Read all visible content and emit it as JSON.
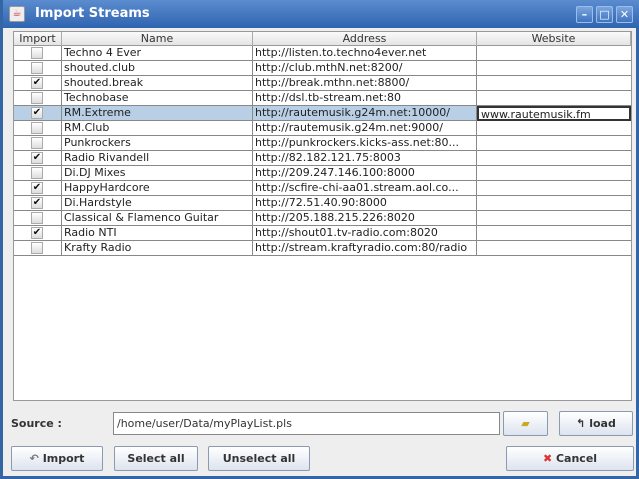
{
  "window": {
    "title": "Import Streams"
  },
  "table": {
    "headers": [
      "Import",
      "Name",
      "Address",
      "Website"
    ],
    "rows": [
      {
        "checked": false,
        "name": "Techno 4 Ever",
        "address": "http://listen.to.techno4ever.net",
        "website": ""
      },
      {
        "checked": false,
        "name": "shouted.club",
        "address": "http://club.mthN.net:8200/",
        "website": ""
      },
      {
        "checked": true,
        "name": "shouted.break",
        "address": "http://break.mthn.net:8800/",
        "website": ""
      },
      {
        "checked": false,
        "name": "Technobase",
        "address": "http://dsl.tb-stream.net:80",
        "website": ""
      },
      {
        "checked": true,
        "name": "RM.Extreme",
        "address": "http://rautemusik.g24m.net:10000/",
        "website": "www.rautemusik.fm",
        "selected": true
      },
      {
        "checked": false,
        "name": "RM.Club",
        "address": "http://rautemusik.g24m.net:9000/",
        "website": ""
      },
      {
        "checked": false,
        "name": "Punkrockers",
        "address": "http://punkrockers.kicks-ass.net:80...",
        "website": ""
      },
      {
        "checked": true,
        "name": "Radio Rivandell",
        "address": "http://82.182.121.75:8003",
        "website": ""
      },
      {
        "checked": false,
        "name": "Di.DJ Mixes",
        "address": "http://209.247.146.100:8000",
        "website": ""
      },
      {
        "checked": true,
        "name": "HappyHardcore",
        "address": "http://scfire-chi-aa01.stream.aol.co...",
        "website": ""
      },
      {
        "checked": true,
        "name": "Di.Hardstyle",
        "address": "http://72.51.40.90:8000",
        "website": ""
      },
      {
        "checked": false,
        "name": "Classical & Flamenco Guitar",
        "address": "http://205.188.215.226:8020",
        "website": ""
      },
      {
        "checked": true,
        "name": "Radio NTI",
        "address": "http://shout01.tv-radio.com:8020",
        "website": ""
      },
      {
        "checked": false,
        "name": "Krafty Radio",
        "address": "http://stream.kraftyradio.com:80/radio",
        "website": ""
      }
    ]
  },
  "source": {
    "label": "Source :",
    "value": "/home/user/Data/myPlayList.pls"
  },
  "buttons": {
    "load": "load",
    "import": "Import",
    "select_all": "Select all",
    "unselect_all": "Unselect all",
    "cancel": "Cancel"
  }
}
